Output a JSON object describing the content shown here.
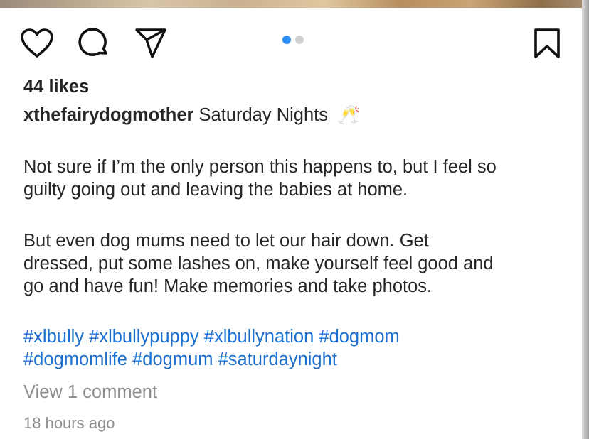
{
  "post": {
    "likes_text": "44 likes",
    "username": "xthefairydogmother",
    "caption_title": "Saturday Nights",
    "caption_emoji": "🥂",
    "paragraph1": [
      "Not sure if I’m the only person this happens to, but I feel so",
      "guilty going out and leaving the babies at home."
    ],
    "paragraph2": [
      "But even dog mums need to let our hair down. Get",
      "dressed, put some lashes on, make yourself feel good and",
      "go and have fun! Make memories and take photos."
    ],
    "hashtags_line1": [
      "#xlbully",
      "#xlbullypuppy",
      "#xlbullynation",
      "#dogmom"
    ],
    "hashtags_line2": [
      "#dogmomlife",
      "#dogmum",
      "#saturdaynight"
    ],
    "view_comments": "View 1 comment",
    "timestamp": "18 hours ago"
  },
  "actions": {
    "icons": [
      "heart-icon",
      "comment-icon",
      "share-icon",
      "bookmark-icon"
    ]
  },
  "carousel": {
    "total": 2,
    "active_index": 0
  },
  "colors": {
    "text": "#262626",
    "hashtag": "#1a6fd0",
    "muted": "#8e8e8e",
    "active_dot": "#2c8ef7",
    "inactive_dot": "#d0d0d0"
  }
}
